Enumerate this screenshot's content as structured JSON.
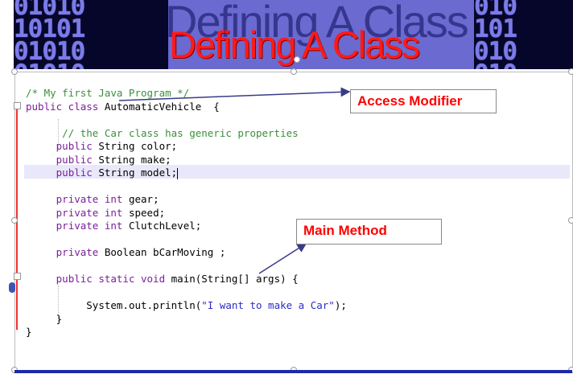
{
  "slide": {
    "title": "Defining A Class",
    "binary_rows_left": [
      "01010",
      "10101",
      "01010"
    ],
    "binary_rows_right": [
      "010",
      "101",
      "010"
    ]
  },
  "code_lines": [
    {
      "indent": "",
      "parts": [
        {
          "t": "/* My first Java Program */",
          "c": "cmt"
        }
      ]
    },
    {
      "indent": "",
      "parts": [
        {
          "t": "public class",
          "c": "kw"
        },
        {
          "t": " AutomaticVehicle  {",
          "c": ""
        }
      ]
    },
    {
      "indent": "",
      "parts": []
    },
    {
      "indent": "      ",
      "parts": [
        {
          "t": "// the Car class has generic properties",
          "c": "cmt"
        }
      ]
    },
    {
      "indent": "     ",
      "parts": [
        {
          "t": "public",
          "c": "kw"
        },
        {
          "t": " String color;",
          "c": ""
        }
      ]
    },
    {
      "indent": "     ",
      "parts": [
        {
          "t": "public",
          "c": "kw"
        },
        {
          "t": " String make;",
          "c": ""
        }
      ]
    },
    {
      "indent": "     ",
      "parts": [
        {
          "t": "public",
          "c": "kw"
        },
        {
          "t": " String model;",
          "c": ""
        }
      ],
      "caret": true
    },
    {
      "indent": "",
      "parts": []
    },
    {
      "indent": "     ",
      "parts": [
        {
          "t": "private int",
          "c": "kw"
        },
        {
          "t": " gear;",
          "c": ""
        }
      ]
    },
    {
      "indent": "     ",
      "parts": [
        {
          "t": "private int",
          "c": "kw"
        },
        {
          "t": " speed;",
          "c": ""
        }
      ]
    },
    {
      "indent": "     ",
      "parts": [
        {
          "t": "private int",
          "c": "kw"
        },
        {
          "t": " ClutchLevel;",
          "c": ""
        }
      ]
    },
    {
      "indent": "",
      "parts": []
    },
    {
      "indent": "     ",
      "parts": [
        {
          "t": "private",
          "c": "kw"
        },
        {
          "t": " Boolean bCarMoving ;",
          "c": ""
        }
      ]
    },
    {
      "indent": "",
      "parts": []
    },
    {
      "indent": "     ",
      "parts": [
        {
          "t": "public static void",
          "c": "kw"
        },
        {
          "t": " main(String[] args) {",
          "c": ""
        }
      ]
    },
    {
      "indent": "",
      "parts": []
    },
    {
      "indent": "          ",
      "parts": [
        {
          "t": "System.out.println(",
          "c": ""
        },
        {
          "t": "\"I want to make a Car\"",
          "c": "str"
        },
        {
          "t": ");",
          "c": ""
        }
      ]
    },
    {
      "indent": "     ",
      "parts": [
        {
          "t": "}",
          "c": ""
        }
      ]
    },
    {
      "indent": "",
      "parts": [
        {
          "t": "}",
          "c": ""
        }
      ]
    }
  ],
  "callouts": {
    "access_modifier": "Access Modifier",
    "main_method": "Main Method"
  },
  "colors": {
    "title_red": "#ff1a1a",
    "keyword": "#7a1f9a",
    "comment": "#3b8f3b",
    "string": "#2c2cc9",
    "callout_text": "#ff0000",
    "banner_purple": "#6a6ad0"
  }
}
